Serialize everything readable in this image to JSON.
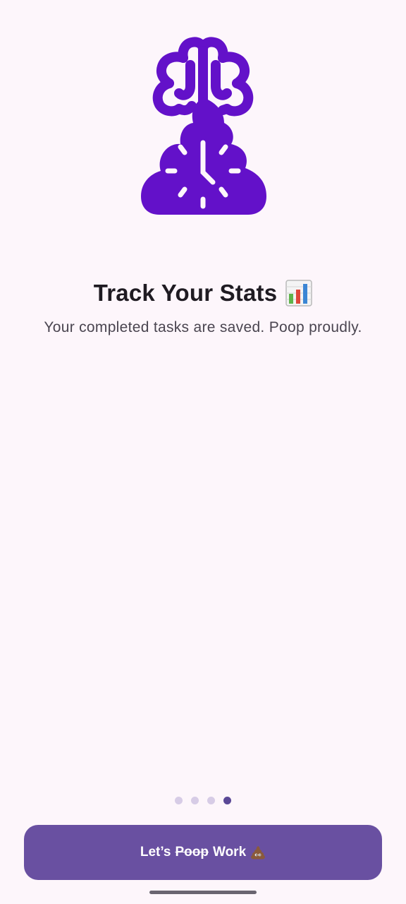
{
  "onboarding": {
    "title": "Track Your Stats",
    "title_emoji": "bar-chart-icon",
    "subtitle": "Your completed tasks are saved. Poop proudly.",
    "pages_total": 4,
    "current_page": 4
  },
  "cta": {
    "prefix": "Let’s",
    "struck_word": "Poop",
    "suffix": "Work",
    "emoji": "poop-icon"
  },
  "colors": {
    "background": "#fdf6fb",
    "brand_purple": "#6311c9",
    "button": "#6950a1",
    "dot_active": "#5a4896",
    "dot_inactive": "#d7cce6"
  }
}
